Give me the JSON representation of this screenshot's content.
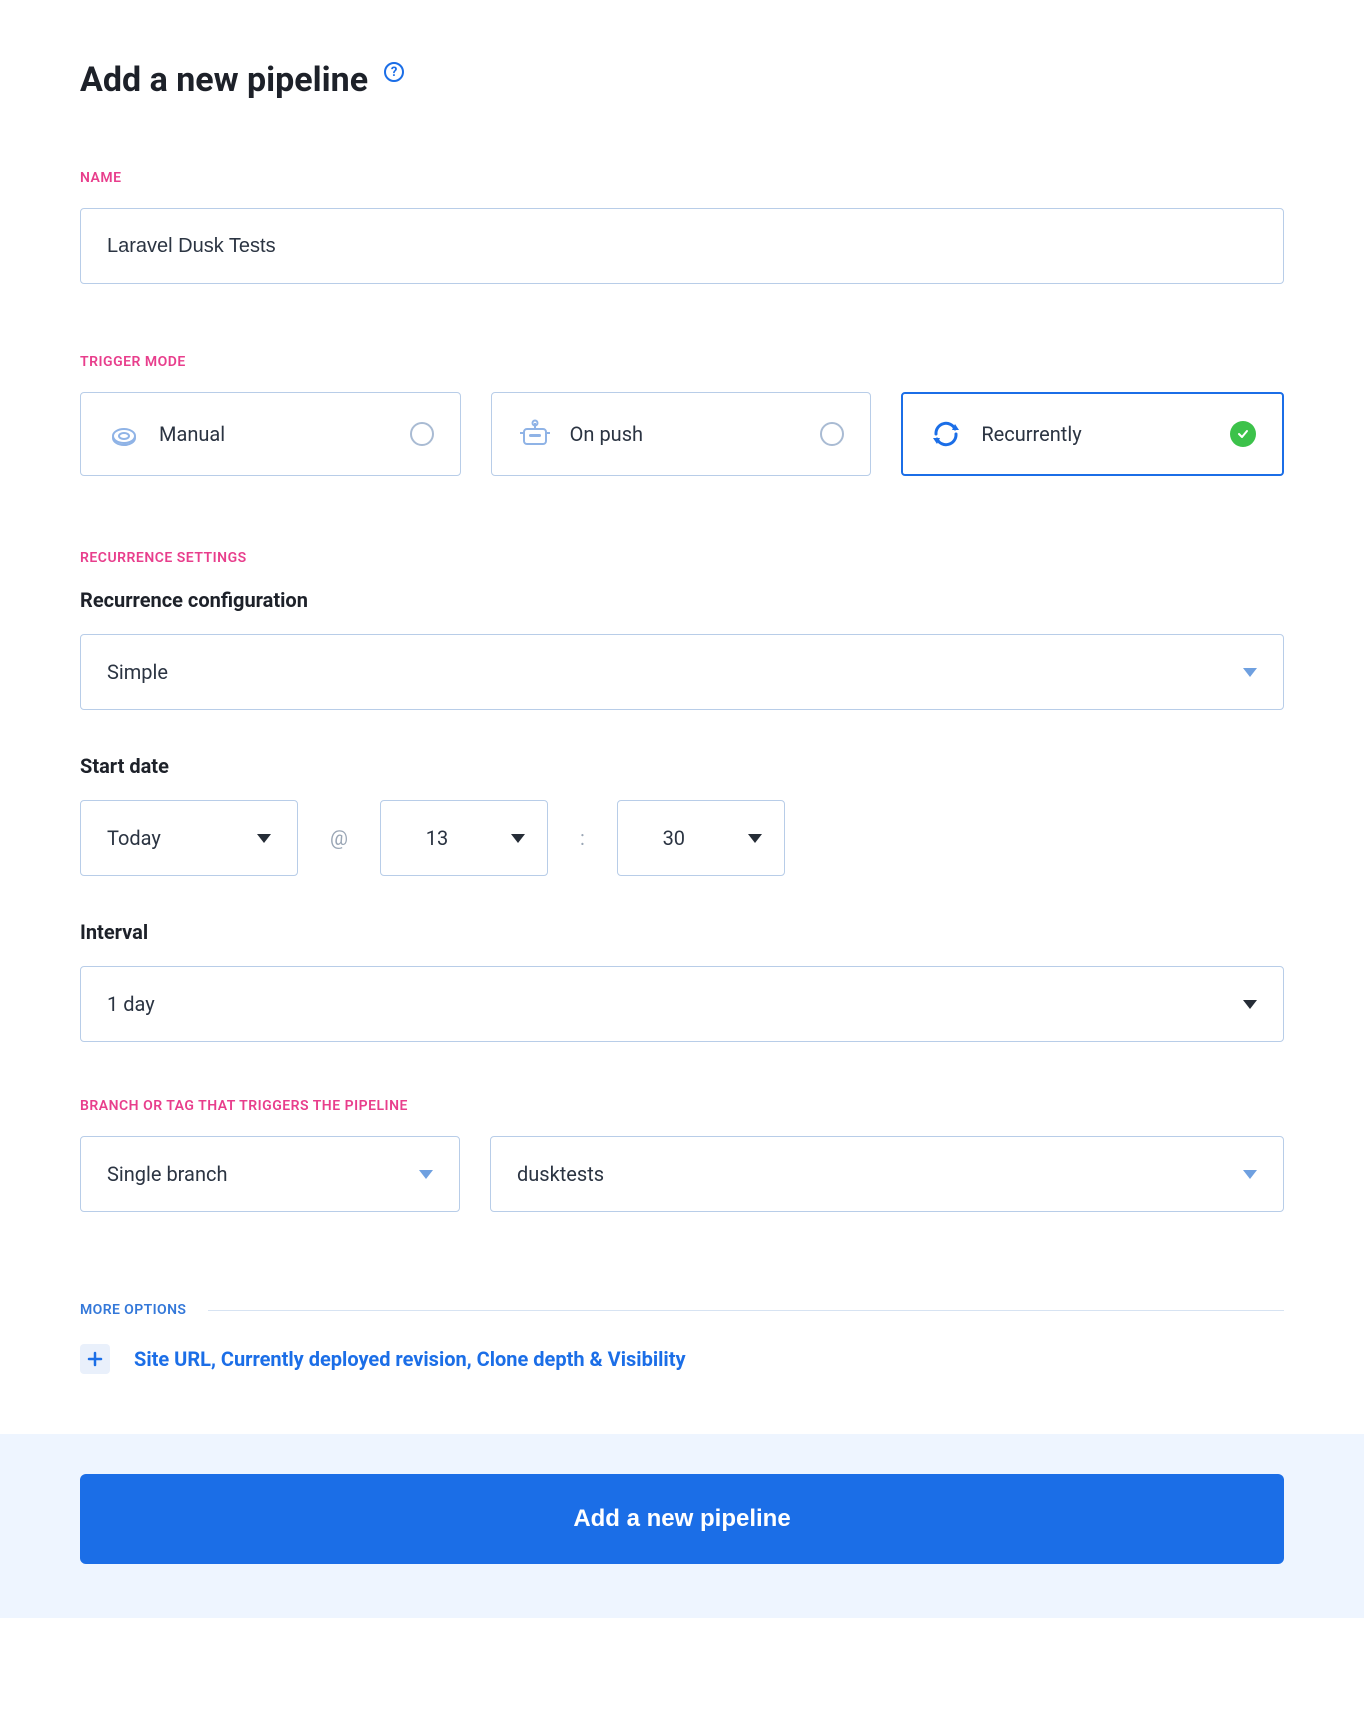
{
  "header": {
    "title": "Add a new pipeline"
  },
  "name_section": {
    "label": "NAME",
    "value": "Laravel Dusk Tests"
  },
  "trigger_section": {
    "label": "TRIGGER MODE",
    "options": {
      "manual": "Manual",
      "on_push": "On push",
      "recurrently": "Recurrently"
    }
  },
  "recurrence": {
    "label": "RECURRENCE SETTINGS",
    "config_label": "Recurrence configuration",
    "config_value": "Simple",
    "start_date_label": "Start date",
    "day_value": "Today",
    "at_separator": "@",
    "hour_value": "13",
    "colon_separator": ":",
    "minute_value": "30",
    "interval_label": "Interval",
    "interval_value": "1 day"
  },
  "branch": {
    "label": "BRANCH OR TAG THAT TRIGGERS THE PIPELINE",
    "mode_value": "Single branch",
    "branch_value": "dusktests"
  },
  "more": {
    "label": "MORE OPTIONS",
    "expand_text": "Site URL, Currently deployed revision, Clone depth & Visibility"
  },
  "footer": {
    "submit_label": "Add a new pipeline"
  }
}
